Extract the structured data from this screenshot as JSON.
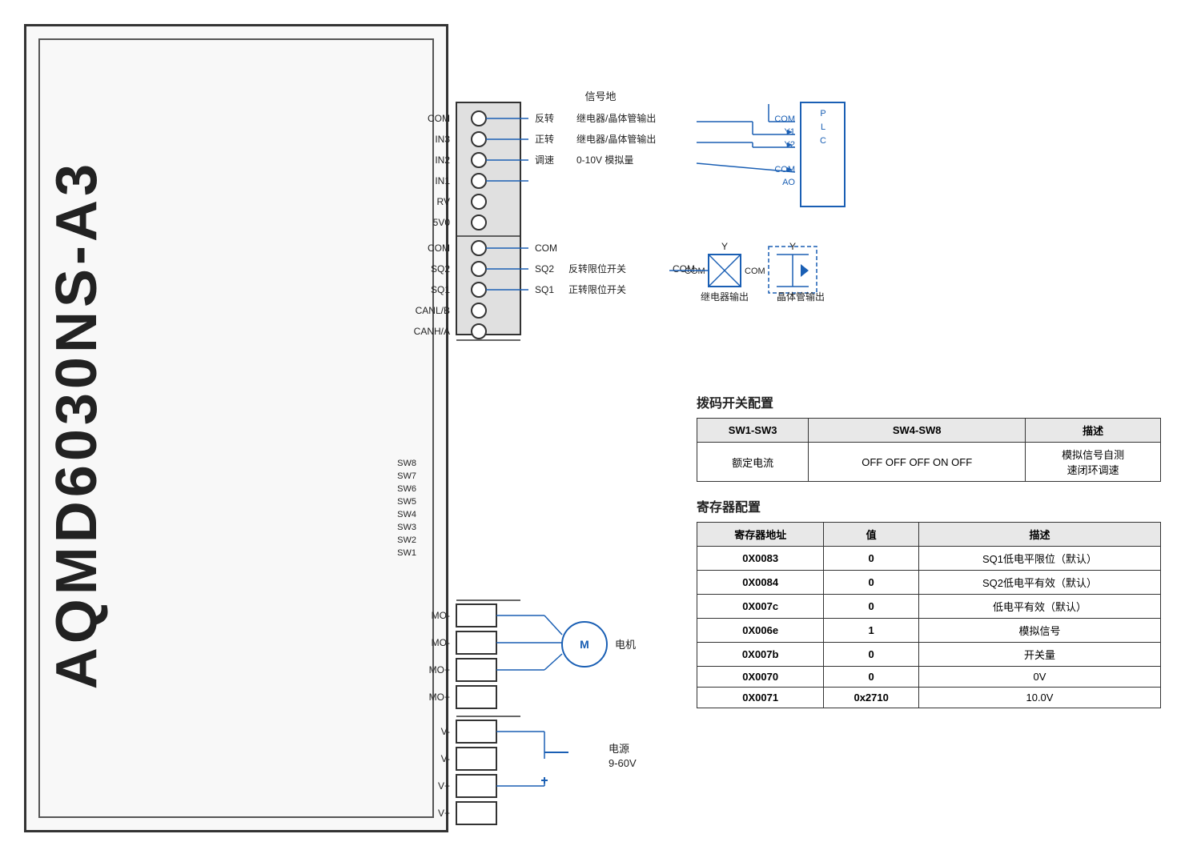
{
  "device": {
    "model": "AQMD6030NS-A3",
    "enclosure_color": "#f8f8f8"
  },
  "terminals_top": [
    {
      "label": "COM",
      "count": 1
    },
    {
      "label": "IN3",
      "count": 1
    },
    {
      "label": "IN2",
      "count": 1
    },
    {
      "label": "IN1",
      "count": 1
    },
    {
      "label": "RV",
      "count": 1
    },
    {
      "label": "5V0",
      "count": 1
    },
    {
      "label": "COM",
      "count": 1
    },
    {
      "label": "SQ2",
      "count": 1
    },
    {
      "label": "SQ1",
      "count": 1
    },
    {
      "label": "CANL/B",
      "count": 1
    },
    {
      "label": "CANH/A",
      "count": 1
    }
  ],
  "switches": [
    "SW8",
    "SW7",
    "SW6",
    "SW5",
    "SW4",
    "SW3",
    "SW2",
    "SW1"
  ],
  "terminals_motor": [
    {
      "label": "MO-"
    },
    {
      "label": "MO-"
    },
    {
      "label": "MO+"
    },
    {
      "label": "MO+"
    }
  ],
  "terminals_power": [
    {
      "label": "V-"
    },
    {
      "label": "V-"
    },
    {
      "label": "V+"
    },
    {
      "label": "V+"
    }
  ],
  "wiring": {
    "signal_ground": "信号地",
    "reverse_label": "反转",
    "forward_label": "正转",
    "speed_label": "调速",
    "reverse_output": "继电器/晶体管输出",
    "forward_output": "继电器/晶体管输出",
    "speed_output": "0-10V 模拟量",
    "com_sq2": "反转限位开关",
    "com_sq1": "正转限位开关",
    "relay_output": "继电器输出",
    "transistor_output": "晶体管输出",
    "plc_label": "PLC",
    "plc_y1": "Y1",
    "plc_y2": "Y2",
    "plc_com1": "COM",
    "plc_com2": "COM",
    "plc_ao": "AO",
    "motor_label": "电机",
    "motor_m": "M",
    "power_label": "电源",
    "power_voltage": "9-60V",
    "com_label": "COM",
    "y_label": "Y"
  },
  "dip_config": {
    "title": "拨码开关配置",
    "headers": [
      "SW1-SW3",
      "SW4-SW8",
      "描述"
    ],
    "rows": [
      {
        "sw1_sw3": "额定电流",
        "sw4_sw8": "OFF OFF OFF ON OFF",
        "desc": "模拟信号自测\n速闭环调速"
      }
    ]
  },
  "register_config": {
    "title": "寄存器配置",
    "headers": [
      "寄存器地址",
      "值",
      "描述"
    ],
    "rows": [
      {
        "addr": "0X0083",
        "val": "0",
        "desc": "SQ1低电平限位（默认）"
      },
      {
        "addr": "0X0084",
        "val": "0",
        "desc": "SQ2低电平有效（默认）"
      },
      {
        "addr": "0X007c",
        "val": "0",
        "desc": "低电平有效（默认）"
      },
      {
        "addr": "0X006e",
        "val": "1",
        "desc": "模拟信号"
      },
      {
        "addr": "0X007b",
        "val": "0",
        "desc": "开关量"
      },
      {
        "addr": "0X0070",
        "val": "0",
        "desc": "0V"
      },
      {
        "addr": "0X0071",
        "val": "0x2710",
        "desc": "10.0V"
      }
    ]
  }
}
